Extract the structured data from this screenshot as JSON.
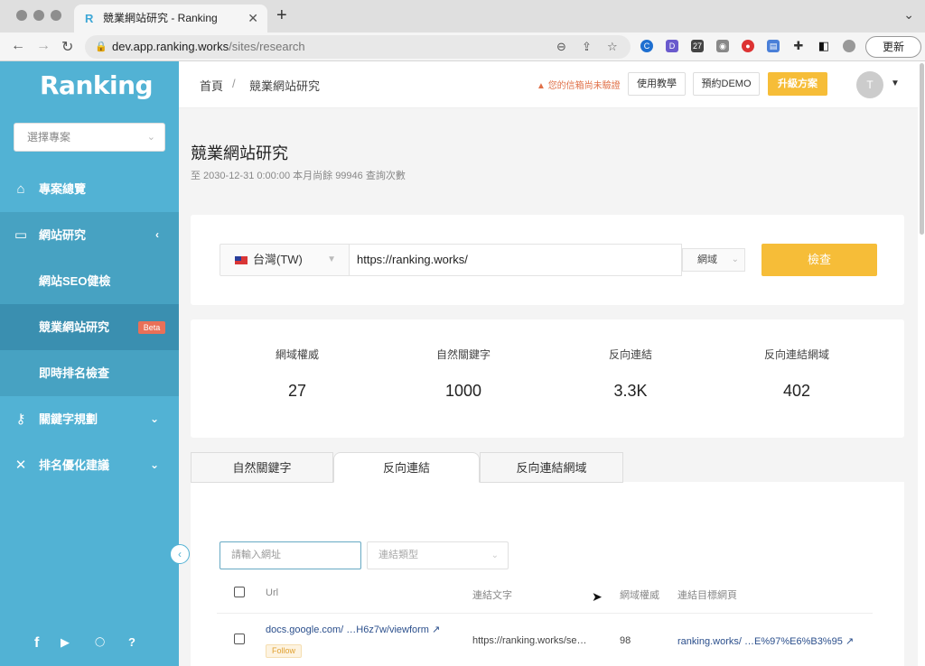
{
  "browser": {
    "tab_title": "競業網站研究 - Ranking",
    "url_host": "dev.app.ranking.works",
    "url_path": "/sites/research",
    "update_label": "更新",
    "extension_badge": "27"
  },
  "sidebar": {
    "logo": "Ranking",
    "project_placeholder": "選擇專案",
    "items": [
      {
        "label": "專案總覽"
      },
      {
        "label": "網站研究"
      },
      {
        "label": "網站SEO健檢"
      },
      {
        "label": "競業網站研究",
        "badge": "Beta"
      },
      {
        "label": "即時排名檢查"
      },
      {
        "label": "關鍵字規劃"
      },
      {
        "label": "排名優化建議"
      }
    ]
  },
  "header": {
    "breadcrumb": [
      "首頁",
      "/",
      "競業網站研究"
    ],
    "warning": "您的信箱尚未驗證",
    "tutorial_label": "使用教學",
    "demo_label": "預約DEMO",
    "upgrade_label": "升級方案",
    "avatar_initial": "T"
  },
  "page": {
    "title": "競業網站研究",
    "subtitle": "至 2030-12-31 0:00:00 本月尚餘 99946 查詢次數"
  },
  "search": {
    "country": "台灣(TW)",
    "url_value": "https://ranking.works/",
    "scope": "網域",
    "submit_label": "檢查"
  },
  "metrics": [
    {
      "label": "網域權威",
      "value": "27"
    },
    {
      "label": "自然關鍵字",
      "value": "1000"
    },
    {
      "label": "反向連結",
      "value": "3.3K"
    },
    {
      "label": "反向連結網域",
      "value": "402"
    }
  ],
  "tabs": [
    "自然關鍵字",
    "反向連結",
    "反向連結網域"
  ],
  "filters": {
    "url_placeholder": "請輸入網址",
    "type_placeholder": "連結類型"
  },
  "table": {
    "headers": [
      "Url",
      "連結文字",
      "網域權威",
      "連結目標網頁"
    ],
    "rows": [
      {
        "url_start": "docs.google.com/",
        "url_end": "…H6z7w/viewform",
        "tag": "Follow",
        "anchor": "https://ranking.works/se…",
        "authority": "98",
        "target_start": "ranking.works/",
        "target_end": "…E%97%E6%B3%95"
      }
    ]
  }
}
